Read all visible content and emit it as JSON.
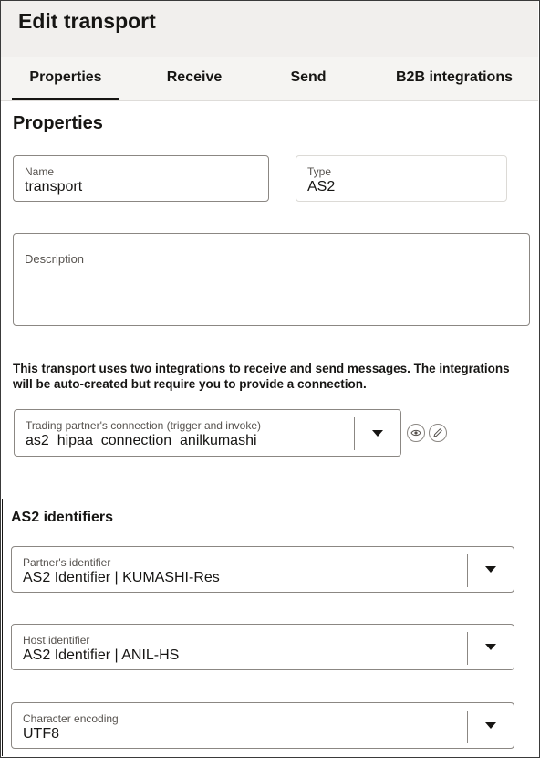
{
  "header": {
    "title": "Edit transport"
  },
  "tabs": [
    {
      "label": "Properties",
      "active": true
    },
    {
      "label": "Receive",
      "active": false
    },
    {
      "label": "Send",
      "active": false
    },
    {
      "label": "B2B integrations",
      "active": false
    }
  ],
  "properties": {
    "section_title": "Properties",
    "name": {
      "label": "Name",
      "value": "transport"
    },
    "type": {
      "label": "Type",
      "value": "AS2"
    },
    "description": {
      "label": "Description",
      "value": ""
    },
    "info_text": "This transport uses two integrations to receive and send messages. The integrations will be auto-created but require you to provide a connection.",
    "connection": {
      "label": "Trading partner's connection (trigger and invoke)",
      "value": "as2_hipaa_connection_anilkumashi"
    }
  },
  "as2": {
    "section_title": "AS2 identifiers",
    "partner_identifier": {
      "label": "Partner's identifier",
      "value": "AS2 Identifier | KUMASHI-Res"
    },
    "host_identifier": {
      "label": "Host identifier",
      "value": "AS2 Identifier | ANIL-HS"
    },
    "character_encoding": {
      "label": "Character encoding",
      "value": "UTF8"
    }
  },
  "icons": {
    "view": "eye-icon",
    "edit": "pencil-icon",
    "dropdown": "caret-down-icon"
  },
  "colors": {
    "header_bg": "#f1efed",
    "text": "#161513",
    "border": "#8b8783"
  }
}
